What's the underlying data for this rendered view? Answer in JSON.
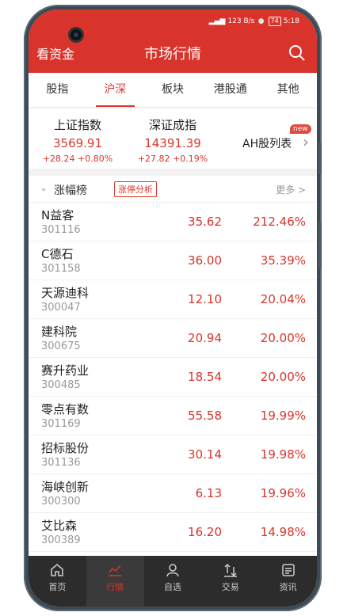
{
  "status": {
    "network": "123 B/s",
    "battery": "74",
    "time": "5:18"
  },
  "header": {
    "left": "看资金",
    "title": "市场行情"
  },
  "tabs": [
    {
      "label": "股指"
    },
    {
      "label": "沪深"
    },
    {
      "label": "板块"
    },
    {
      "label": "港股通"
    },
    {
      "label": "其他"
    }
  ],
  "indices": [
    {
      "name": "上证指数",
      "value": "3569.91",
      "change": "+28.24 +0.80%"
    },
    {
      "name": "深证成指",
      "value": "14391.39",
      "change": "+27.82 +0.19%"
    }
  ],
  "ah": {
    "label": "AH股列表",
    "badge": "new"
  },
  "list": {
    "title": "涨幅榜",
    "badge": "涨停分析",
    "more": "更多 >",
    "rows": [
      {
        "name": "N益客",
        "code": "301116",
        "price": "35.62",
        "pct": "212.46%"
      },
      {
        "name": "C德石",
        "code": "301158",
        "price": "36.00",
        "pct": "35.39%"
      },
      {
        "name": "天源迪科",
        "code": "300047",
        "price": "12.10",
        "pct": "20.04%"
      },
      {
        "name": "建科院",
        "code": "300675",
        "price": "20.94",
        "pct": "20.00%"
      },
      {
        "name": "赛升药业",
        "code": "300485",
        "price": "18.54",
        "pct": "20.00%"
      },
      {
        "name": "零点有数",
        "code": "301169",
        "price": "55.58",
        "pct": "19.99%"
      },
      {
        "name": "招标股份",
        "code": "301136",
        "price": "30.14",
        "pct": "19.98%"
      },
      {
        "name": "海峡创新",
        "code": "300300",
        "price": "6.13",
        "pct": "19.96%"
      },
      {
        "name": "艾比森",
        "code": "300389",
        "price": "16.20",
        "pct": "14.98%"
      }
    ]
  },
  "nav": [
    {
      "label": "首页",
      "icon": "home-icon"
    },
    {
      "label": "行情",
      "icon": "chart-icon"
    },
    {
      "label": "自选",
      "icon": "person-icon"
    },
    {
      "label": "交易",
      "icon": "trade-icon"
    },
    {
      "label": "资讯",
      "icon": "news-icon"
    }
  ],
  "colors": {
    "brand": "#d9342b",
    "up": "#d9342b",
    "nav_bg": "#2c2c2c"
  }
}
